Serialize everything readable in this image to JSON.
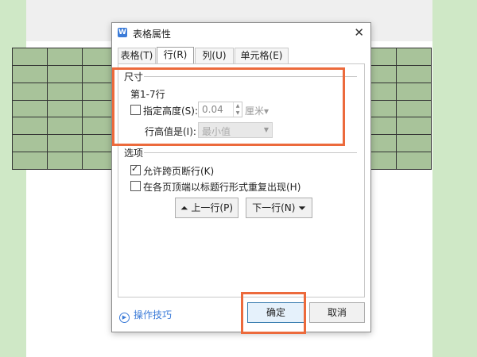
{
  "dialog": {
    "title": "表格属性",
    "app_icon": "W"
  },
  "tabs": [
    {
      "label": "表格(T)"
    },
    {
      "label": "行(R)"
    },
    {
      "label": "列(U)"
    },
    {
      "label": "单元格(E)"
    }
  ],
  "size_section": {
    "label": "尺寸",
    "rows_text": "第1-7行",
    "specify_height_label": "指定高度(S):",
    "specify_height_checked": false,
    "height_value": "0.04",
    "unit_label": "厘米▾",
    "row_height_is_label": "行高值是(I):",
    "row_height_mode": "最小值"
  },
  "options_section": {
    "label": "选项",
    "allow_break_label": "允许跨页断行(K)",
    "allow_break_checked": true,
    "repeat_header_label": "在各页顶端以标题行形式重复出现(H)",
    "repeat_header_checked": false
  },
  "nav": {
    "prev_row": "⏶ 上一行(P)",
    "next_row": "下一行(N) ⏷"
  },
  "footer": {
    "help_icon": "▶",
    "help_link": "操作技巧",
    "ok": "确定",
    "cancel": "取消"
  },
  "colors": {
    "highlight": "#ec6a3c",
    "table_fill": "#a8c39a",
    "background": "#cfe8c6"
  }
}
